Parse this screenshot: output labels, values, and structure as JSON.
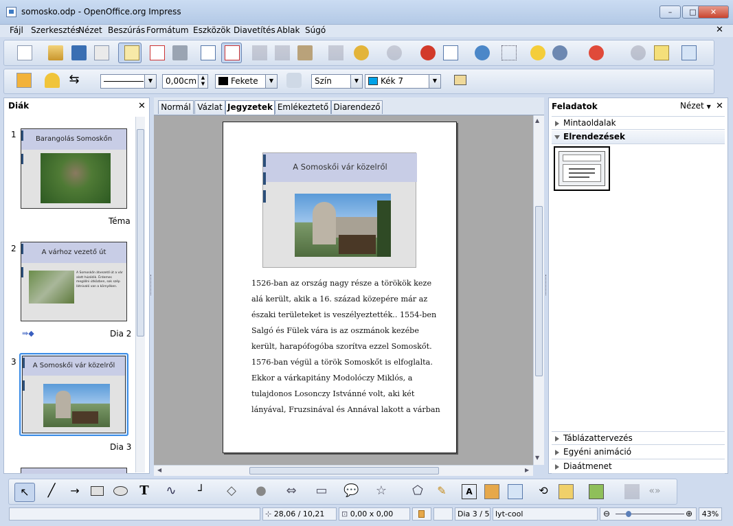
{
  "window": {
    "title": "somosko.odp - OpenOffice.org Impress",
    "minimize": "–",
    "maximize": "□",
    "close": "✕"
  },
  "menu": [
    "Fájl",
    "Szerkesztés",
    "Nézet",
    "Beszúrás",
    "Formátum",
    "Eszközök",
    "Diavetítés",
    "Ablak",
    "Súgó"
  ],
  "doc_close": "✕",
  "line_toolbar": {
    "line_width": "0,00cm",
    "line_color": "Fekete",
    "area_style": "Szín",
    "area_color": "Kék 7",
    "line_color_hex": "#000000",
    "area_color_hex": "#00a2e8"
  },
  "slides_pane": {
    "title": "Diák",
    "close": "✕",
    "slides": [
      {
        "number": "1",
        "title": "Barangolás Somoskőn",
        "label": "Téma"
      },
      {
        "number": "2",
        "title": "A várhoz vezető út",
        "label": "Dia 2",
        "text": "A Somoskőn átvezető út a vár alatt húzódik. Érdemes megállni útközben, sok szép látnivaló van a környéken."
      },
      {
        "number": "3",
        "title": "A Somoskői vár közelről",
        "label": "Dia 3"
      }
    ]
  },
  "view_tabs": [
    "Normál",
    "Vázlat",
    "Jegyzetek",
    "Emlékeztető",
    "Diarendező"
  ],
  "active_tab": "Jegyzetek",
  "notes_page": {
    "slide_title": "A Somoskői vár közelről",
    "lines": [
      "1526-ban az ország nagy része a törökök keze",
      "alá került, akik a 16. század közepére már az",
      "északi területeket is veszélyeztették.. 1554-ben",
      "Salgó és Fülek vára is az oszmánok kezébe",
      "került, harapófogóba szorítva ezzel Somoskőt.",
      "1576-ban végül  a török Somoskőt is elfoglalta.",
      "Ekkor a várkapitány Modolóczy Miklós, a",
      "tulajdonos Losonczy Istvánné volt, aki két",
      "lányával, Fruzsinával és Annával lakott a várban"
    ]
  },
  "task_pane": {
    "title": "Feladatok",
    "view_menu": "Nézet",
    "close": "✕",
    "sections_top": [
      {
        "label": "Mintaoldalak",
        "expanded": false
      },
      {
        "label": "Elrendezések",
        "expanded": true
      }
    ],
    "sections_bottom": [
      {
        "label": "Táblázattervezés",
        "expanded": false
      },
      {
        "label": "Egyéni animáció",
        "expanded": false
      },
      {
        "label": "Diaátmenet",
        "expanded": false
      }
    ]
  },
  "statusbar": {
    "position": "28,06 / 10,21",
    "size": "0,00 x 0,00",
    "slide": "Dia 3 / 5",
    "master": "lyt-cool",
    "zoom": "43%"
  }
}
